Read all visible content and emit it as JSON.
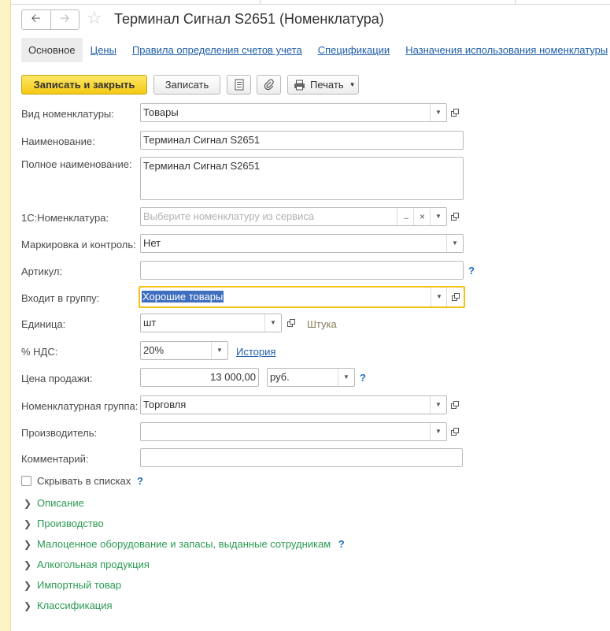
{
  "window": {
    "title": "Терминал Сигнал S2651 (Номенклатура)",
    "back_icon": "arrow-left",
    "forward_icon": "arrow-right",
    "favorite_icon": "star"
  },
  "tabs": [
    {
      "label": "Основное",
      "active": true
    },
    {
      "label": "Цены"
    },
    {
      "label": "Правила определения счетов учета"
    },
    {
      "label": "Спецификации"
    },
    {
      "label": "Назначения использования номенклатуры"
    }
  ],
  "toolbar": {
    "save_close": "Записать и закрыть",
    "save": "Записать",
    "print": "Печать"
  },
  "form": {
    "kind": {
      "label": "Вид номенклатуры:",
      "value": "Товары"
    },
    "name": {
      "label": "Наименование:",
      "value": "Терминал Сигнал S2651"
    },
    "full_name": {
      "label": "Полное наименование:",
      "value": "Терминал Сигнал S2651"
    },
    "nomenclature_1c": {
      "label": "1С:Номенклатура:",
      "placeholder": "Выберите номенклатуру из сервиса"
    },
    "marking": {
      "label": "Маркировка и контроль:",
      "value": "Нет"
    },
    "article": {
      "label": "Артикул:",
      "value": ""
    },
    "group": {
      "label": "Входит в группу:",
      "value": "Хорошие товары"
    },
    "unit": {
      "label": "Единица:",
      "value": "шт",
      "note": "Штука"
    },
    "vat": {
      "label": "% НДС:",
      "value": "20%",
      "link": "История"
    },
    "price": {
      "label": "Цена продажи:",
      "value": "13 000,00",
      "currency": "руб."
    },
    "item_group": {
      "label": "Номенклатурная группа:",
      "value": "Торговля"
    },
    "manufacturer": {
      "label": "Производитель:",
      "value": ""
    },
    "comment": {
      "label": "Комментарий:",
      "value": ""
    },
    "hide_in_lists": {
      "label": "Скрывать в списках",
      "checked": false
    },
    "help_mark": "?",
    "clear_mark": "×",
    "dots_mark": "..."
  },
  "groups": [
    {
      "label": "Описание"
    },
    {
      "label": "Производство"
    },
    {
      "label": "Малоценное оборудование и запасы, выданные сотрудникам",
      "help": "?"
    },
    {
      "label": "Алкогольная продукция"
    },
    {
      "label": "Импортный товар"
    },
    {
      "label": "Классификация"
    }
  ],
  "colors": {
    "accent_yellow": "#f4c913",
    "link_blue": "#1e5eaa",
    "group_green": "#2a9a52",
    "selection_blue": "#3f6fbf"
  }
}
